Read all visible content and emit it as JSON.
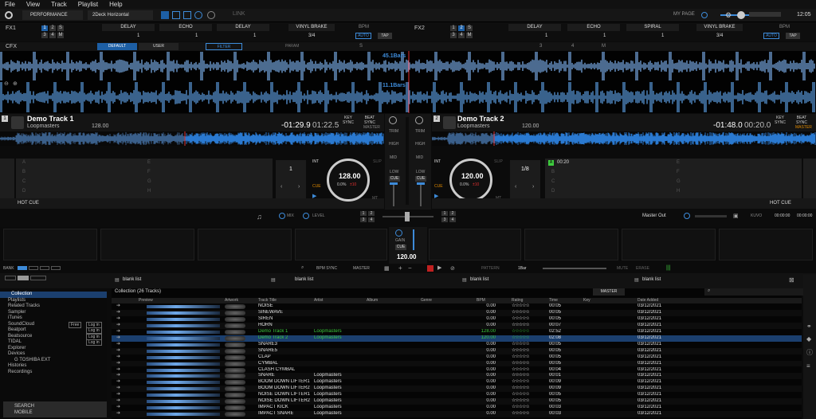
{
  "menu": [
    "File",
    "View",
    "Track",
    "Playlist",
    "Help"
  ],
  "topbar": {
    "mode": "PERFORMANCE",
    "layout": "2Deck Horizontal",
    "link": "LINK",
    "mypage": "MY PAGE",
    "clock": "12:05"
  },
  "fx1": {
    "label": "FX1",
    "nums": [
      "1",
      "2",
      "S",
      "3",
      "4",
      "M"
    ],
    "slots": [
      "DELAY",
      "ECHO",
      "DELAY"
    ],
    "vals": [
      "1",
      "1",
      "1"
    ],
    "brake": "VINYL BRAKE",
    "frac": "3/4",
    "bpm": "BPM",
    "auto": "AUTO",
    "tap": "TAP"
  },
  "fx2": {
    "label": "FX2",
    "nums": [
      "1",
      "2",
      "S",
      "3",
      "4",
      "M"
    ],
    "slots": [
      "DELAY",
      "ECHO",
      "SPIRAL"
    ],
    "vals": [
      "1",
      "1",
      "1"
    ],
    "brake": "VINYL BRAKE",
    "frac": "3/4",
    "bpm": "BPM",
    "auto": "AUTO",
    "tap": "TAP"
  },
  "cfx": {
    "label": "CFX",
    "default": "DEFAULT",
    "user": "USER",
    "filter": "FILTER",
    "param": "PARAM",
    "s": "S",
    "nums": [
      "3",
      "4",
      "M"
    ]
  },
  "wave": {
    "bars1": "45.1Bars",
    "bars2": "11.1Bars"
  },
  "deck1": {
    "num": "1",
    "title": "Demo Track 1",
    "artist": "Loopmasters",
    "bpm": "128.00",
    "remain": "-01:29.9",
    "elapsed": "01:22.5",
    "keysync": "KEY SYNC",
    "beatsync": "BEAT SYNC",
    "master": "MASTER",
    "jog_bpm": "128.00",
    "jog_pct": "0.0%",
    "jog_range": "±10",
    "int": "INT",
    "slip": "SLIP",
    "cue": "CUE",
    "loop": "1",
    "mt": "MT",
    "hotcue": "HOT CUE",
    "hc_letters": [
      "A",
      "B",
      "C",
      "D",
      "E",
      "F",
      "G",
      "H"
    ]
  },
  "deck2": {
    "num": "2",
    "title": "Demo Track 2",
    "artist": "Loopmasters",
    "bpm": "120.00",
    "remain": "-01:48.0",
    "elapsed": "00:20.0",
    "keysync": "KEY SYNC",
    "beatsync": "BEAT SYNC",
    "master": "MASTER",
    "jog_bpm": "120.00",
    "jog_pct": "0.0%",
    "jog_range": "±10",
    "int": "INT",
    "slip": "SLIP",
    "cue": "CUE",
    "loop": "1/8",
    "mt": "MT",
    "hotcue": "HOT CUE",
    "hc_a": "00:20",
    "hc_letters": [
      "A",
      "B",
      "C",
      "D",
      "E",
      "F",
      "G",
      "H"
    ]
  },
  "mixer": {
    "trim": "TRIM",
    "high": "HIGH",
    "mid": "MID",
    "low": "LOW",
    "cue": "CUE",
    "gain": "GAIN",
    "master_bpm": "120.00",
    "mix": "MIX",
    "level": "LEVEL",
    "master_out": "Master Out",
    "rec_time": "00:00:00",
    "rec_time2": "00:00:00",
    "kuvo": "KUVO",
    "nums": [
      "1",
      "2",
      "3",
      "4"
    ]
  },
  "sampler": {
    "bank": "BANK",
    "bpmsync": "BPM SYNC",
    "master": "MASTER",
    "pattern": "PATTERN",
    "bar": "1Bar",
    "mute": "MUTE",
    "erase": "ERASE"
  },
  "panels": [
    "blank list",
    "blank list",
    "blank list",
    "blank list"
  ],
  "tree": {
    "items": [
      "Collection",
      "Playlists",
      "Related Tracks",
      "Sampler",
      "iTunes",
      "SoundCloud",
      "Beatport",
      "Beatsource",
      "TIDAL",
      "Explorer",
      "Devices",
      "G TOSHIBA EXT",
      "Histories",
      "Recordings"
    ],
    "free": "Free",
    "login": "Log in",
    "search": "SEARCH",
    "mobile": "MOBILE"
  },
  "table": {
    "collection": "Collection (26 Tracks)",
    "master": "MASTER",
    "headers": [
      "Preview",
      "Artwork",
      "Track Title",
      "Artist",
      "Album",
      "Genre",
      "BPM",
      "Rating",
      "Time",
      "Key",
      "Date Added"
    ],
    "rows": [
      [
        "NOISE",
        "",
        "0.00",
        "00:05",
        "03/12/2021"
      ],
      [
        "SINEWAVE",
        "",
        "0.00",
        "00:05",
        "03/12/2021"
      ],
      [
        "SIREN",
        "",
        "0.00",
        "00:05",
        "03/12/2021"
      ],
      [
        "HORN",
        "",
        "0.00",
        "00:07",
        "03/12/2021"
      ],
      [
        "Demo Track 1",
        "Loopmasters",
        "128.00",
        "02:52",
        "03/12/2021"
      ],
      [
        "Demo Track 2",
        "Loopmasters",
        "120.00",
        "02:08",
        "03/12/2021"
      ],
      [
        "SNARE3",
        "",
        "0.00",
        "00:05",
        "03/12/2021"
      ],
      [
        "SNARE5",
        "",
        "0.00",
        "00:05",
        "03/12/2021"
      ],
      [
        "CLAP",
        "",
        "0.00",
        "00:05",
        "03/12/2021"
      ],
      [
        "CYMBAL",
        "",
        "0.00",
        "00:05",
        "03/12/2021"
      ],
      [
        "CLASH CYMBAL",
        "",
        "0.00",
        "00:04",
        "03/12/2021"
      ],
      [
        "SNARE",
        "Loopmasters",
        "0.00",
        "00:01",
        "03/12/2021"
      ],
      [
        "BOOM DOWN LIFTER1",
        "Loopmasters",
        "0.00",
        "00:09",
        "03/12/2021"
      ],
      [
        "BOOM DOWN LIFTER2",
        "Loopmasters",
        "0.00",
        "00:09",
        "03/12/2021"
      ],
      [
        "NOISE DOWN LIFTER1",
        "Loopmasters",
        "0.00",
        "00:05",
        "03/12/2021"
      ],
      [
        "NOISE DOWN LIFTER2",
        "Loopmasters",
        "0.00",
        "00:05",
        "03/12/2021"
      ],
      [
        "IMPACT KICK",
        "Loopmasters",
        "0.00",
        "00:03",
        "03/12/2021"
      ],
      [
        "IMPACT SNARE",
        "Loopmasters",
        "0.00",
        "00:03",
        "03/12/2021"
      ]
    ],
    "stars": "☆☆☆☆☆"
  },
  "colors": {
    "accent": "#3d8bd9",
    "cue": "#e08a00",
    "green": "#3ecb3e",
    "selected": "#1b3f6e"
  }
}
